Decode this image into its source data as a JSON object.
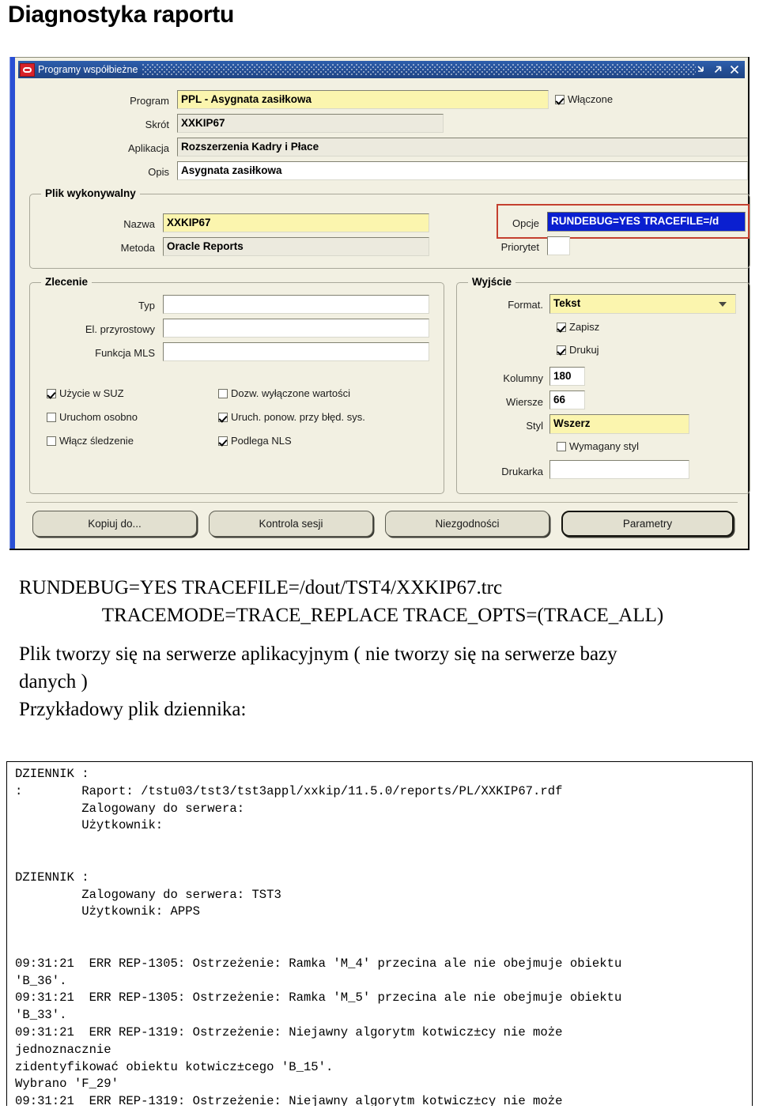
{
  "page": {
    "title": "Diagnostyka raportu"
  },
  "window": {
    "title": "Programy współbieżne",
    "logo_icon": "oracle-logo-icon",
    "buttons": {
      "minimize": "minimize-icon",
      "restore": "restore-icon",
      "close": "close-icon"
    }
  },
  "form": {
    "program": {
      "label": "Program",
      "value": "PPL - Asygnata zasiłkowa"
    },
    "enabled": {
      "label": "Włączone",
      "checked": true
    },
    "skrot": {
      "label": "Skrót",
      "value": "XXKIP67"
    },
    "aplikacja": {
      "label": "Aplikacja",
      "value": "Rozszerzenia Kadry i Płace"
    },
    "opis": {
      "label": "Opis",
      "value": "Asygnata zasiłkowa"
    },
    "executable": {
      "title": "Plik wykonywalny",
      "nazwa": {
        "label": "Nazwa",
        "value": "XXKIP67"
      },
      "metoda": {
        "label": "Metoda",
        "value": "Oracle Reports"
      },
      "opcje": {
        "label": "Opcje",
        "value": "RUNDEBUG=YES TRACEFILE=/d"
      },
      "priorytet": {
        "label": "Priorytet",
        "value": ""
      }
    },
    "zlecenie": {
      "title": "Zlecenie",
      "typ": {
        "label": "Typ",
        "value": ""
      },
      "el_przyrostowy": {
        "label": "El. przyrostowy",
        "value": ""
      },
      "funkcja_mls": {
        "label": "Funkcja MLS",
        "value": ""
      }
    },
    "checkboxes": [
      {
        "label": "Użycie w SUZ",
        "checked": true
      },
      {
        "label": "Dozw. wyłączone wartości",
        "checked": false
      },
      {
        "label": "Uruchom osobno",
        "checked": false
      },
      {
        "label": "Uruch. ponow. przy błęd. sys.",
        "checked": true
      },
      {
        "label": "Włącz śledzenie",
        "checked": false
      },
      {
        "label": "Podlega NLS",
        "checked": true
      }
    ],
    "wyjscie": {
      "title": "Wyjście",
      "format": {
        "label": "Format.",
        "value": "Tekst"
      },
      "zapisz": {
        "label": "Zapisz",
        "checked": true
      },
      "drukuj": {
        "label": "Drukuj",
        "checked": true
      },
      "kolumny": {
        "label": "Kolumny",
        "value": "180"
      },
      "wiersze": {
        "label": "Wiersze",
        "value": "66"
      },
      "styl": {
        "label": "Styl",
        "value": "Wszerz"
      },
      "wymagany_styl": {
        "label": "Wymagany styl",
        "checked": false
      },
      "drukarka": {
        "label": "Drukarka",
        "value": ""
      }
    },
    "buttons": [
      {
        "label": "Kopiuj do...",
        "primary": false
      },
      {
        "label": "Kontrola sesji",
        "primary": false
      },
      {
        "label": "Niezgodności",
        "primary": false
      },
      {
        "label": "Parametry",
        "primary": true
      }
    ]
  },
  "prose": {
    "line1": "RUNDEBUG=YES TRACEFILE=/dout/TST4/XXKIP67.trc",
    "line2": "TRACEMODE=TRACE_REPLACE TRACE_OPTS=(TRACE_ALL)",
    "line3": "Plik tworzy się na serwerze aplikacyjnym ( nie tworzy się na serwerze bazy",
    "line4": "danych )",
    "line5": "Przykładowy plik dziennika:"
  },
  "log": {
    "text": "DZIENNIK :\n:        Raport: /tstu03/tst3/tst3appl/xxkip/11.5.0/reports/PL/XXKIP67.rdf\n         Zalogowany do serwera:\n         Użytkownik:\n\n\nDZIENNIK :\n         Zalogowany do serwera: TST3\n         Użytkownik: APPS\n\n\n09:31:21  ERR REP-1305: Ostrzeżenie: Ramka 'M_4' przecina ale nie obejmuje obiektu\n'B_36'.\n09:31:21  ERR REP-1305: Ostrzeżenie: Ramka 'M_5' przecina ale nie obejmuje obiektu\n'B_33'.\n09:31:21  ERR REP-1319: Ostrzeżenie: Niejawny algorytm kotwicz±cy nie może\njednoznacznie\nzidentyfikować obiektu kotwicz±cego 'B_15'.\nWybrano 'F_29'\n09:31:21  ERR REP-1319: Ostrzeżenie: Niejawny algorytm kotwicz±cy nie może"
  }
}
